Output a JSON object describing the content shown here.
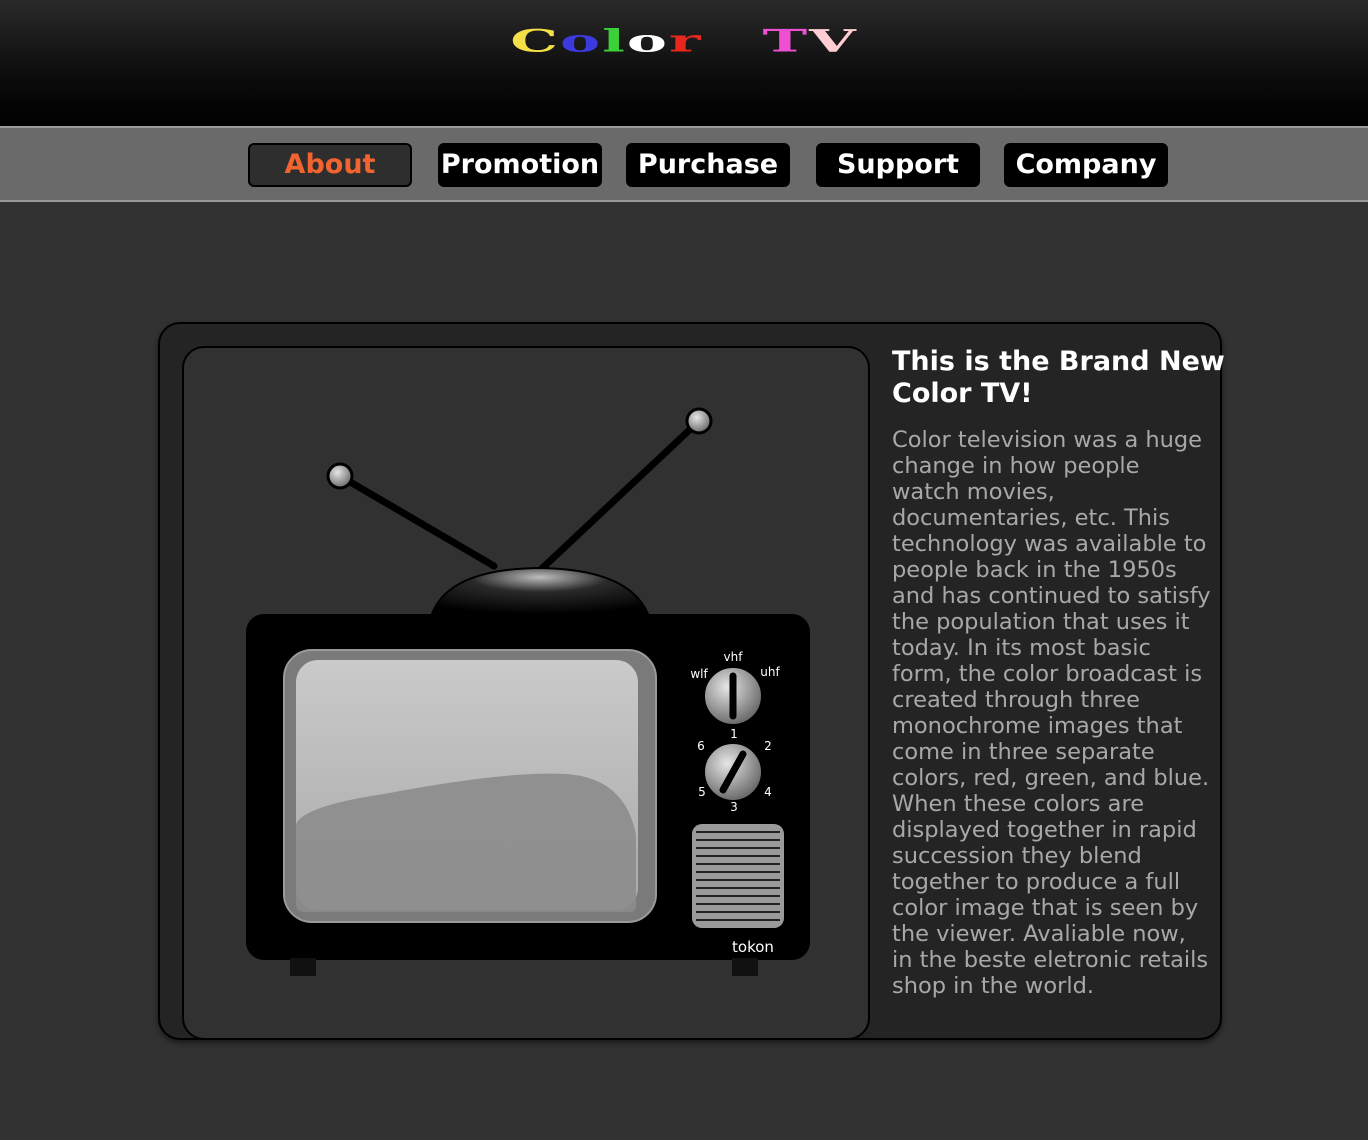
{
  "header": {
    "logo": {
      "word1": [
        {
          "ch": "C",
          "color": "#f5e04a"
        },
        {
          "ch": "o",
          "color": "#3a3adf"
        },
        {
          "ch": "l",
          "color": "#3ad13a"
        },
        {
          "ch": "o",
          "color": "#ffffff"
        },
        {
          "ch": "r",
          "color": "#e8271c"
        }
      ],
      "word2": [
        {
          "ch": "T",
          "color": "#ef4fd2"
        },
        {
          "ch": "V",
          "color": "#ffcdd2"
        }
      ]
    }
  },
  "nav": {
    "items": [
      {
        "label": "About",
        "active": true
      },
      {
        "label": "Promotion",
        "active": false
      },
      {
        "label": "Purchase",
        "active": false
      },
      {
        "label": "Support",
        "active": false
      },
      {
        "label": "Company",
        "active": false
      }
    ],
    "active_color": "#f2642f"
  },
  "main": {
    "title": "This is the Brand New Color TV!",
    "description": "Color television was a huge change in how people watch movies, documentaries, etc. This technology was available to people back in the 1950s and has continued to satisfy the population that uses it today. In its most basic form, the color broadcast is created through three monochrome images that come in three separate colors, red, green, and blue. When these colors are displayed together in rapid succession they blend together to produce a full color image that is seen by the viewer. Avaliable now, in the beste eletronic retails shop in the world.",
    "tv_image": {
      "icon": "television-icon",
      "knob1_labels": {
        "top": "vhf",
        "left": "wlf",
        "right": "uhf"
      },
      "knob2_labels": [
        "1",
        "2",
        "3",
        "4",
        "5",
        "6"
      ],
      "brand": "tokon"
    }
  }
}
